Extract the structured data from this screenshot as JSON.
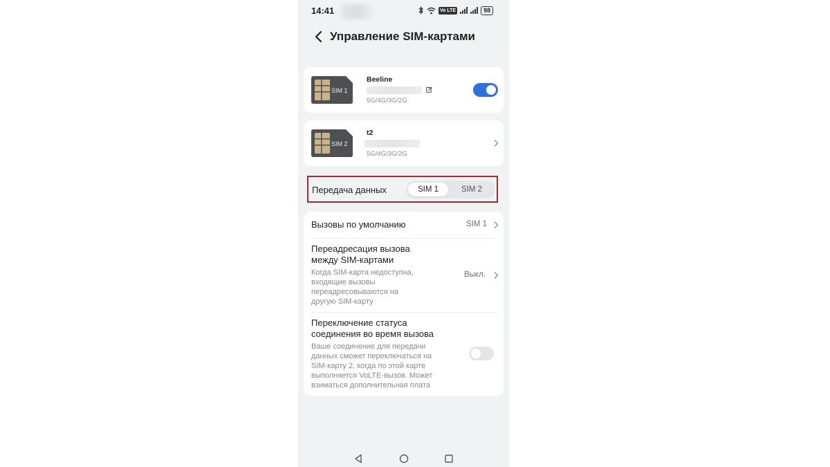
{
  "status_bar": {
    "time": "14:41",
    "battery": "98",
    "volte_tag": "Vo LTE"
  },
  "header": {
    "title": "Управление SIM-картами"
  },
  "sim1": {
    "sim_label": "SIM 1",
    "carrier": "Beeline",
    "network": "5G/4G/3G/2G",
    "enabled": true
  },
  "sim2": {
    "sim_label": "SIM 2",
    "carrier": "t2",
    "network": "5G/4G/3G/2G"
  },
  "data_transfer": {
    "label": "Передача данных",
    "options": [
      "SIM 1",
      "SIM 2"
    ],
    "selected": "SIM 1"
  },
  "default_calls": {
    "title": "Вызовы по умолчанию",
    "value": "SIM 1"
  },
  "call_forwarding": {
    "title_line1": "Переадресация вызова",
    "title_line2": "между SIM-картами",
    "desc_lines": [
      "Когда SIM-карта недоступна,",
      "входящие вызовы",
      "переадресовываются на",
      "другую SIM-карту"
    ],
    "value": "Выкл."
  },
  "status_switch": {
    "title_line1": "Переключение статуса",
    "title_line2": "соединения во время вызова",
    "desc_lines": [
      "Ваше соединение для передачи",
      "данных сможет переключаться на",
      "SIM-карту 2, когда по этой карте",
      "выполняется VoLTE-вызов. Может",
      "взиматься дополнительная плата"
    ],
    "enabled": false
  },
  "icons": {
    "back": "chevron-left-icon",
    "edit": "edit-icon",
    "chevron": "chevron-right-icon"
  },
  "colors": {
    "accent": "#2f6fe0",
    "highlight_border": "#a32a2e",
    "background": "#f1f2f4"
  }
}
